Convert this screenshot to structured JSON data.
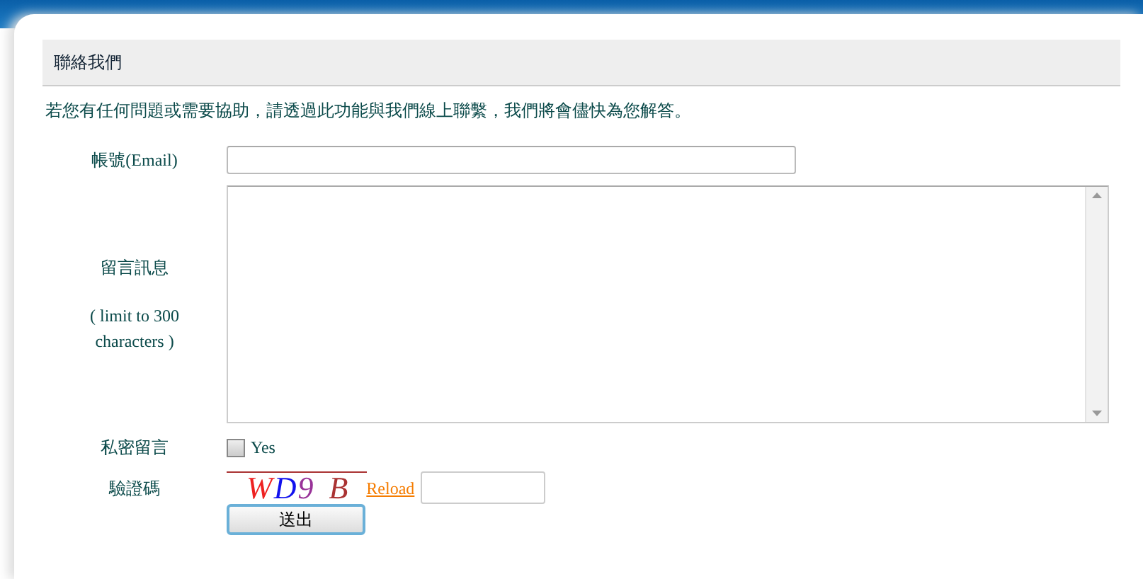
{
  "panel": {
    "title": "聯絡我們",
    "intro": "若您有任何問題或需要協助，請透過此功能與我們線上聯繫，我們將會儘快為您解答。"
  },
  "form": {
    "email_label": "帳號(Email)",
    "message_label": "留言訊息",
    "message_hint": "( limit to 300 characters )",
    "private_label": "私密留言",
    "private_option": {
      "label": "Yes",
      "checked": false
    },
    "captcha_label": "驗證碼",
    "captcha": [
      {
        "char": "W",
        "color": "#ee2222"
      },
      {
        "char": "D",
        "color": "#1111ee"
      },
      {
        "char": "9",
        "color": "#993399"
      },
      {
        "char": "B",
        "color": "#aa3333"
      }
    ],
    "reload": "Reload",
    "submit": "送出"
  }
}
